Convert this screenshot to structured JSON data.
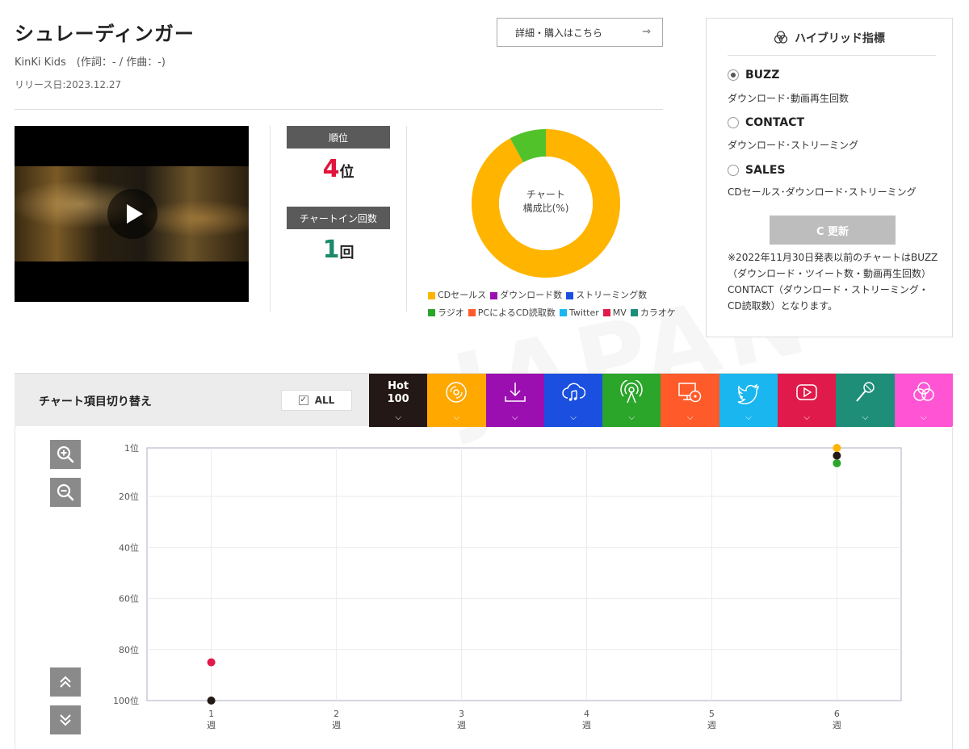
{
  "song": {
    "title": "シュレーディンガー",
    "credit": "KinKi Kids　(作詞：- / 作曲：-)",
    "release": "リリース日:2023.12.27",
    "detail_button": "詳細・購入はこちら",
    "detail_arrow": "⇾"
  },
  "rank": {
    "label": "順位",
    "value": "4",
    "unit": "位",
    "chartin_label": "チャートイン回数",
    "chartin_value": "1",
    "chartin_unit": "回"
  },
  "composition": {
    "caption_line1": "チャート",
    "caption_line2": "構成比(%)",
    "slices": [
      {
        "name": "CDセールス",
        "value": 92,
        "color": "#FFB400"
      },
      {
        "name": "ラジオ",
        "value": 8,
        "color": "#52C22A"
      }
    ],
    "legend": [
      {
        "label": "CDセールス",
        "color": "#FFB400"
      },
      {
        "label": "ダウンロード数",
        "color": "#9B0FB0"
      },
      {
        "label": "ストリーミング数",
        "color": "#1A4FE0"
      },
      {
        "label": "ラジオ",
        "color": "#2BA52A"
      },
      {
        "label": "PCによるCD読取数",
        "color": "#FF5A2A"
      },
      {
        "label": "Twitter",
        "color": "#19B6F0"
      },
      {
        "label": "MV",
        "color": "#E01A4A"
      },
      {
        "label": "カラオケ",
        "color": "#1E8E78"
      }
    ]
  },
  "hybrid": {
    "title": "ハイブリッド指標",
    "options": [
      {
        "label": "BUZZ",
        "desc": "ダウンロード･動画再生回数",
        "selected": true
      },
      {
        "label": "CONTACT",
        "desc": "ダウンロード･ストリーミング",
        "selected": false
      },
      {
        "label": "SALES",
        "desc": "CDセールス･ダウンロード･ストリーミング",
        "selected": false
      }
    ],
    "update_button": "C 更新",
    "note": "※2022年11月30日発表以前のチャートはBUZZ（ダウンロード・ツイート数・動画再生回数）CONTACT（ダウンロード・ストリーミング・CD読取数）となります。"
  },
  "toolbar": {
    "title": "チャート項目切り替え",
    "all_label": "ALL",
    "tabs": [
      {
        "id": "hot100",
        "label_line1": "Hot",
        "label_line2": "100",
        "color": "#231815",
        "icon": "text"
      },
      {
        "id": "cd",
        "color": "#FFA800",
        "icon": "cd-icon"
      },
      {
        "id": "download",
        "color": "#9B0FB0",
        "icon": "download-icon"
      },
      {
        "id": "streaming",
        "color": "#1A4FE0",
        "icon": "cloud-music-icon"
      },
      {
        "id": "radio",
        "color": "#2BA52A",
        "icon": "radio-icon"
      },
      {
        "id": "pc-cd",
        "color": "#FF5A2A",
        "icon": "pc-cd-icon"
      },
      {
        "id": "twitter",
        "color": "#19B6F0",
        "icon": "twitter-icon"
      },
      {
        "id": "mv",
        "color": "#E01A4A",
        "icon": "play-video-icon"
      },
      {
        "id": "karaoke",
        "color": "#1E8E78",
        "icon": "microphone-icon"
      },
      {
        "id": "hybrid",
        "color": "#FF55D4",
        "icon": "hybrid-circles-icon"
      }
    ],
    "chevron": "⌄"
  },
  "chart_data": {
    "type": "scatter",
    "y_reversed": true,
    "ylim": [
      1,
      100
    ],
    "y_ticks": [
      {
        "value": 1,
        "label": "1位"
      },
      {
        "value": 20,
        "label": "20位"
      },
      {
        "value": 40,
        "label": "40位"
      },
      {
        "value": 60,
        "label": "60位"
      },
      {
        "value": 80,
        "label": "80位"
      },
      {
        "value": 100,
        "label": "100位"
      }
    ],
    "x": [
      1,
      2,
      3,
      4,
      5,
      6
    ],
    "x_labels": [
      {
        "num": "1",
        "unit": "週"
      },
      {
        "num": "2",
        "unit": "週"
      },
      {
        "num": "3",
        "unit": "週"
      },
      {
        "num": "4",
        "unit": "週"
      },
      {
        "num": "5",
        "unit": "週"
      },
      {
        "num": "6",
        "unit": "週"
      }
    ],
    "series": [
      {
        "color": "#231815",
        "points": [
          {
            "x": 1,
            "y": 100
          },
          {
            "x": 6,
            "y": 4
          }
        ]
      },
      {
        "color": "#E01A4A",
        "points": [
          {
            "x": 1,
            "y": 85
          }
        ]
      },
      {
        "color": "#FFB400",
        "points": [
          {
            "x": 6,
            "y": 1
          }
        ]
      },
      {
        "color": "#2BA52A",
        "points": [
          {
            "x": 6,
            "y": 7
          }
        ]
      }
    ],
    "grid": true
  }
}
